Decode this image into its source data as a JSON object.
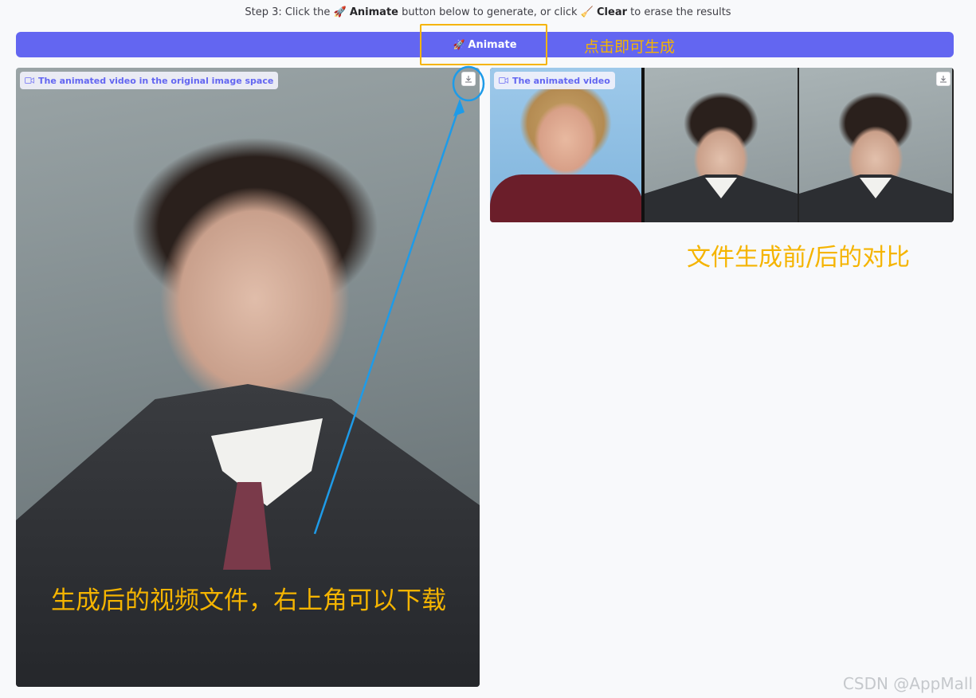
{
  "instructions": {
    "prefix": "Step 3: Click the",
    "animate_word": "Animate",
    "middle": "button below to generate, or click",
    "clear_word": "Clear",
    "suffix": "to erase the results",
    "rocket_glyph": "🚀",
    "broom_glyph": "🧹"
  },
  "animate_button": {
    "label": "Animate",
    "icon": "rocket-icon",
    "color": "#6366f1"
  },
  "left_panel": {
    "label": "The animated video in the original image space",
    "download_icon": "download-icon"
  },
  "right_panel": {
    "label": "The animated video",
    "download_icon": "download-icon"
  },
  "annotations": {
    "button_note": "点击即可生成",
    "compare_note": "文件生成前/后的对比",
    "download_note": "生成后的视频文件，右上角可以下载",
    "color": "#f5b400",
    "arrow_color": "#1e9be8"
  },
  "watermark": "CSDN @AppMall"
}
